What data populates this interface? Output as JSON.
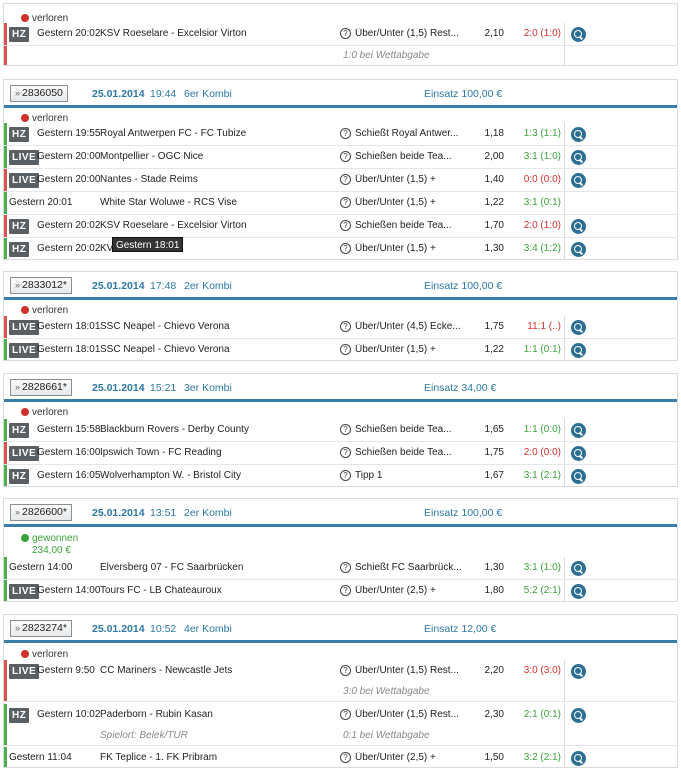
{
  "colors": {
    "lost": "#d0312d",
    "won": "#3aa23a",
    "accent": "#2d78a4",
    "bar_lost": "#d9534f",
    "bar_won": "#4caf50"
  },
  "icons": {
    "zoom": "magnifier-icon",
    "help": "question-icon",
    "expand": "double-chevron-icon"
  },
  "tooltip": "Gestern 18:01",
  "blocks": [
    {
      "status": "verloren",
      "rows": [
        {
          "badge": "HZ",
          "time": "Gestern 20:02",
          "match": "KSV Roeselare - Excelsior Virton",
          "market": "Über/Unter (1,5) Rest...",
          "odds": "2,10",
          "result": "2:0 (1:0)",
          "res": "red"
        }
      ],
      "note": "1:0 bei Wettabgabe"
    },
    {
      "id": "2836050",
      "date": "25.01.2014",
      "time": "19:44",
      "type": "6er Kombi",
      "stake": "Einsatz 100,00 €",
      "status": "verloren",
      "rows": [
        {
          "badge": "HZ",
          "time": "Gestern 19:55",
          "match": "Royal Antwerpen FC - FC Tubize",
          "market": "Schießt Royal Antwer...",
          "odds": "1,18",
          "result": "1:3 (1:1)",
          "res": "green"
        },
        {
          "badge": "LIVE",
          "time": "Gestern 20:00",
          "match": "Montpellier - OGC Nice",
          "market": "Schießen beide Tea...",
          "odds": "2,00",
          "result": "3:1 (1:0)",
          "res": "green"
        },
        {
          "badge": "LIVE",
          "time": "Gestern 20:00",
          "match": "Nantes - Stade Reims",
          "market": "Über/Unter (1,5) +",
          "odds": "1,40",
          "result": "0:0 (0:0)",
          "res": "red"
        },
        {
          "badge": "",
          "time": "Gestern 20:01",
          "match": "White Star Woluwe - RCS Vise",
          "market": "Über/Unter (1,5) +",
          "odds": "1,22",
          "result": "3:1 (0:1)",
          "res": "green"
        },
        {
          "badge": "HZ",
          "time": "Gestern 20:02",
          "match": "KSV Roeselare - Excelsior Virton",
          "market": "Schießen beide Tea...",
          "odds": "1,70",
          "result": "2:0 (1:0)",
          "res": "red"
        },
        {
          "badge": "HZ",
          "time": "Gestern 20:02",
          "match": "KV                SK",
          "market": "Über/Unter (1,5) +",
          "odds": "1,30",
          "result": "3:4 (1:2)",
          "res": "green"
        }
      ]
    },
    {
      "id": "2833012*",
      "date": "25.01.2014",
      "time": "17:48",
      "type": "2er Kombi",
      "stake": "Einsatz 100,00 €",
      "status": "verloren",
      "rows": [
        {
          "badge": "LIVE",
          "time": "Gestern 18:01",
          "match": "SSC Neapel - Chievo Verona",
          "market": "Über/Unter (4,5) Ecke...",
          "odds": "1,75",
          "result": "11:1 (..)",
          "res": "red"
        },
        {
          "badge": "LIVE",
          "time": "Gestern 18:01",
          "match": "SSC Neapel - Chievo Verona",
          "market": "Über/Unter (1,5) +",
          "odds": "1,22",
          "result": "1:1 (0:1)",
          "res": "green"
        }
      ]
    },
    {
      "id": "2828661*",
      "date": "25.01.2014",
      "time": "15:21",
      "type": "3er Kombi",
      "stake": "Einsatz 34,00 €",
      "status": "verloren",
      "rows": [
        {
          "badge": "HZ",
          "time": "Gestern 15:58",
          "match": "Blackburn Rovers - Derby County",
          "market": "Schießen beide Tea...",
          "odds": "1,65",
          "result": "1:1 (0:0)",
          "res": "green"
        },
        {
          "badge": "LIVE",
          "time": "Gestern 16:00",
          "match": "Ipswich Town - FC Reading",
          "market": "Schießen beide Tea...",
          "odds": "1,75",
          "result": "2:0 (0:0)",
          "res": "red"
        },
        {
          "badge": "HZ",
          "time": "Gestern 16:05",
          "match": "Wolverhampton W. - Bristol City",
          "market": "Tipp 1",
          "odds": "1,67",
          "result": "3:1 (2:1)",
          "res": "green"
        }
      ]
    },
    {
      "id": "2826600*",
      "date": "25.01.2014",
      "time": "13:51",
      "type": "2er Kombi",
      "stake": "Einsatz 100,00 €",
      "status": "gewonnen",
      "win": "234,00 €",
      "rows": [
        {
          "badge": "",
          "time": "Gestern 14:00",
          "match": "Elversberg 07 - FC Saarbrücken",
          "market": "Schießt FC Saarbrück...",
          "odds": "1,30",
          "result": "3:1 (1:0)",
          "res": "green"
        },
        {
          "badge": "LIVE",
          "time": "Gestern 14:00",
          "match": "Tours FC - LB Chateauroux",
          "market": "Über/Unter (2,5) +",
          "odds": "1,80",
          "result": "5:2 (2:1)",
          "res": "green"
        }
      ]
    },
    {
      "id": "2823274*",
      "date": "25.01.2014",
      "time": "10:52",
      "type": "4er Kombi",
      "stake": "Einsatz 12,00 €",
      "status": "verloren",
      "rows": [
        {
          "badge": "LIVE",
          "time": "Gestern 9:50",
          "match": "CC Mariners - Newcastle Jets",
          "market": "Über/Unter (1,5) Rest...",
          "odds": "2,20",
          "result": "3:0 (3:0)",
          "res": "red",
          "note": "3:0 bei Wettabgabe"
        },
        {
          "badge": "HZ",
          "time": "Gestern 10:02",
          "match": "Paderborn - Rubin Kasan",
          "market": "Über/Unter (1,5) Rest...",
          "odds": "2,30",
          "result": "2:1 (0:1)",
          "res": "green",
          "note": "0:1 bei Wettabgabe",
          "note_left": "Spielort: Belek/TUR"
        },
        {
          "badge": "",
          "time": "Gestern 11:04",
          "match": "FK Teplice - 1. FK Pribram",
          "market": "Über/Unter (2,5) +",
          "odds": "1,50",
          "result": "3:2 (2:1)",
          "res": "green"
        }
      ]
    }
  ]
}
